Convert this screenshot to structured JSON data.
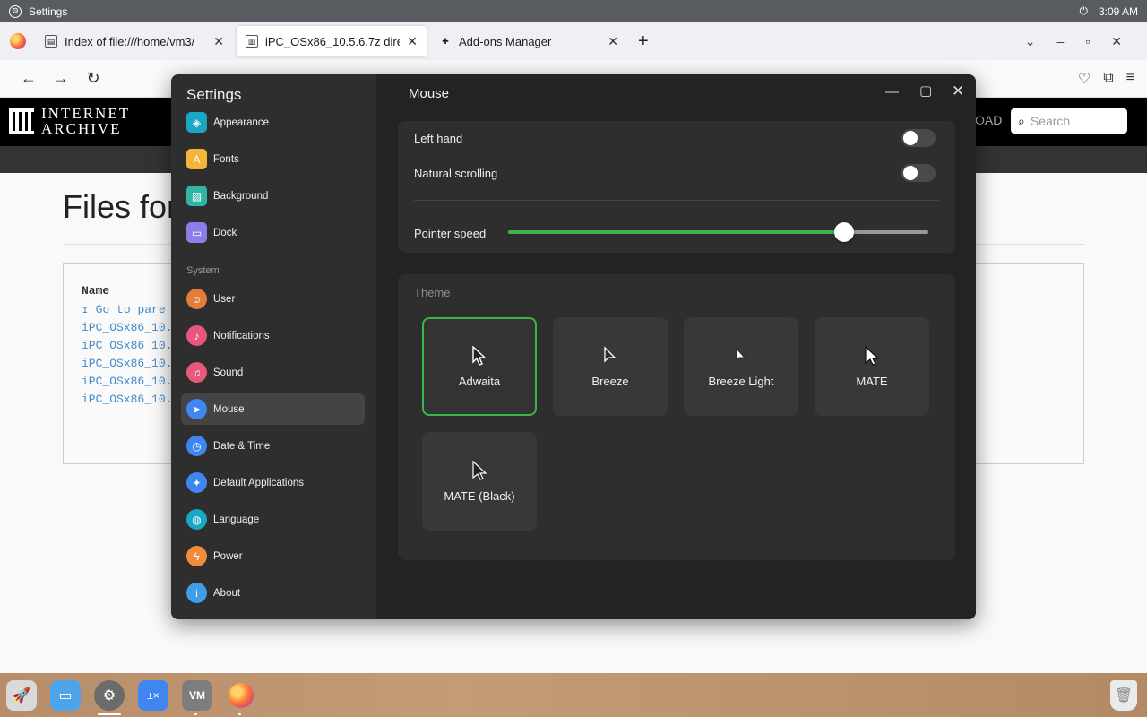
{
  "topbar": {
    "app_name": "Settings",
    "time": "3:09 AM"
  },
  "browser": {
    "tabs": [
      {
        "title": "Index of file:///home/vm3/"
      },
      {
        "title": "iPC_OSx86_10.5.6.7z direc"
      },
      {
        "title": "Add-ons Manager"
      }
    ]
  },
  "ia": {
    "logo_line1": "INTERNET",
    "logo_line2": "ARCHIVE",
    "upload_label": "OAD",
    "search_placeholder": "Search",
    "page_title": "Files for",
    "name_header": "Name",
    "parent_link": "Go to pare",
    "files": [
      "iPC_OSx86_10.",
      "iPC_OSx86_10.",
      "iPC_OSx86_10.",
      "iPC_OSx86_10.",
      "iPC_OSx86_10."
    ]
  },
  "settings": {
    "window_title": "Settings",
    "page_title": "Mouse",
    "section_system": "System",
    "sidebar": [
      {
        "label": "Appearance",
        "icon": "appearance-icon",
        "color": "#1aa7c4"
      },
      {
        "label": "Fonts",
        "icon": "fonts-icon",
        "color": "#f5b43b"
      },
      {
        "label": "Background",
        "icon": "background-icon",
        "color": "#2fb5a2"
      },
      {
        "label": "Dock",
        "icon": "dock-icon",
        "color": "#8a7ee8"
      },
      {
        "label": "User",
        "icon": "user-icon",
        "color": "#e57c3a"
      },
      {
        "label": "Notifications",
        "icon": "notifications-icon",
        "color": "#e9577e"
      },
      {
        "label": "Sound",
        "icon": "sound-icon",
        "color": "#e9577e"
      },
      {
        "label": "Mouse",
        "icon": "mouse-icon",
        "color": "#3f86f0"
      },
      {
        "label": "Date & Time",
        "icon": "clock-icon",
        "color": "#3f86f0"
      },
      {
        "label": "Default Applications",
        "icon": "default-apps-icon",
        "color": "#3f86f0"
      },
      {
        "label": "Language",
        "icon": "globe-icon",
        "color": "#1aa7c4"
      },
      {
        "label": "Power",
        "icon": "power-icon",
        "color": "#f08d3b"
      },
      {
        "label": "About",
        "icon": "info-icon",
        "color": "#3f9ee8"
      }
    ],
    "left_hand_label": "Left hand",
    "natural_scrolling_label": "Natural scrolling",
    "pointer_speed_label": "Pointer speed",
    "pointer_speed_value": 0.8,
    "theme_label": "Theme",
    "themes": [
      "Adwaita",
      "Breeze",
      "Breeze Light",
      "MATE",
      "MATE (Black)"
    ],
    "selected_theme": "Adwaita",
    "accent_color": "#3cb54a"
  },
  "dock": {
    "apps": [
      "launcher-icon",
      "files-icon",
      "settings-icon",
      "calculator-icon",
      "vmware-icon",
      "firefox-icon",
      "trash-icon"
    ]
  }
}
